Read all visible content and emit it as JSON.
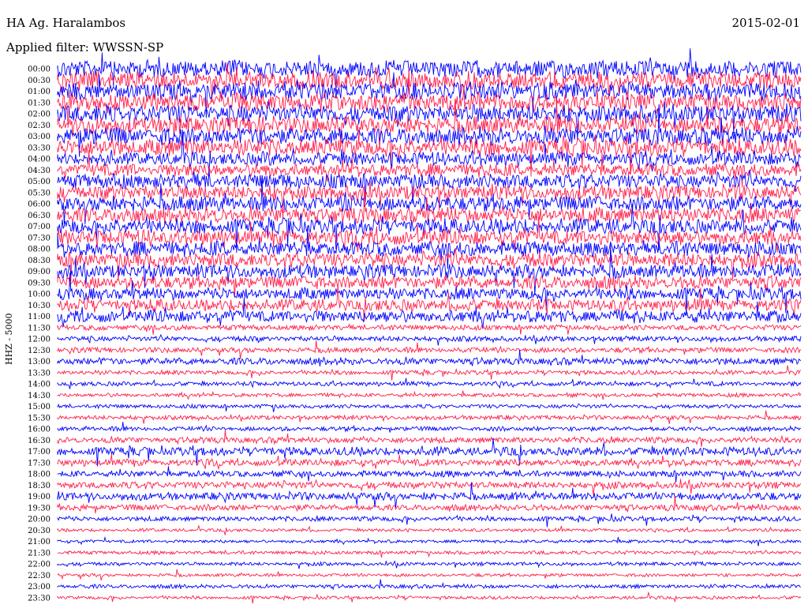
{
  "header": {
    "station": "HA Ag. Haralambos",
    "date": "2015-02-01",
    "filter": "Applied filter: WWSSN-SP",
    "channel_label": "HHZ - 5000"
  },
  "colors": {
    "line_a": "#0000ff",
    "line_b": "#ff1f4b"
  },
  "chart_data": {
    "type": "helicorder",
    "title": "HA Ag. Haralambos",
    "row_labels": [
      "00:00",
      "00:30",
      "01:00",
      "01:30",
      "02:00",
      "02:30",
      "03:00",
      "03:30",
      "04:00",
      "04:30",
      "05:00",
      "05:30",
      "06:00",
      "06:30",
      "07:00",
      "07:30",
      "08:00",
      "08:30",
      "09:00",
      "09:30",
      "10:00",
      "10:30",
      "11:00",
      "11:30",
      "12:00",
      "12:30",
      "13:00",
      "13:30",
      "14:00",
      "14:30",
      "15:00",
      "15:30",
      "16:00",
      "16:30",
      "17:00",
      "17:30",
      "18:00",
      "18:30",
      "19:00",
      "19:30",
      "20:00",
      "20:30",
      "21:00",
      "21:30",
      "22:00",
      "22:30",
      "23:00",
      "23:30"
    ],
    "row_colors": [
      "#0000ff",
      "#ff1f4b"
    ],
    "ylabel": "HHZ - 5000",
    "relative_amplitude": [
      1.0,
      1.0,
      1.0,
      1.0,
      1.0,
      1.0,
      1.0,
      1.0,
      0.8,
      0.75,
      0.85,
      0.85,
      0.9,
      0.9,
      0.9,
      0.9,
      0.85,
      0.85,
      0.8,
      0.75,
      0.7,
      0.7,
      0.7,
      0.3,
      0.3,
      0.3,
      0.4,
      0.25,
      0.25,
      0.22,
      0.22,
      0.25,
      0.25,
      0.35,
      0.5,
      0.4,
      0.35,
      0.4,
      0.45,
      0.35,
      0.28,
      0.18,
      0.18,
      0.2,
      0.2,
      0.18,
      0.22,
      0.18
    ]
  }
}
